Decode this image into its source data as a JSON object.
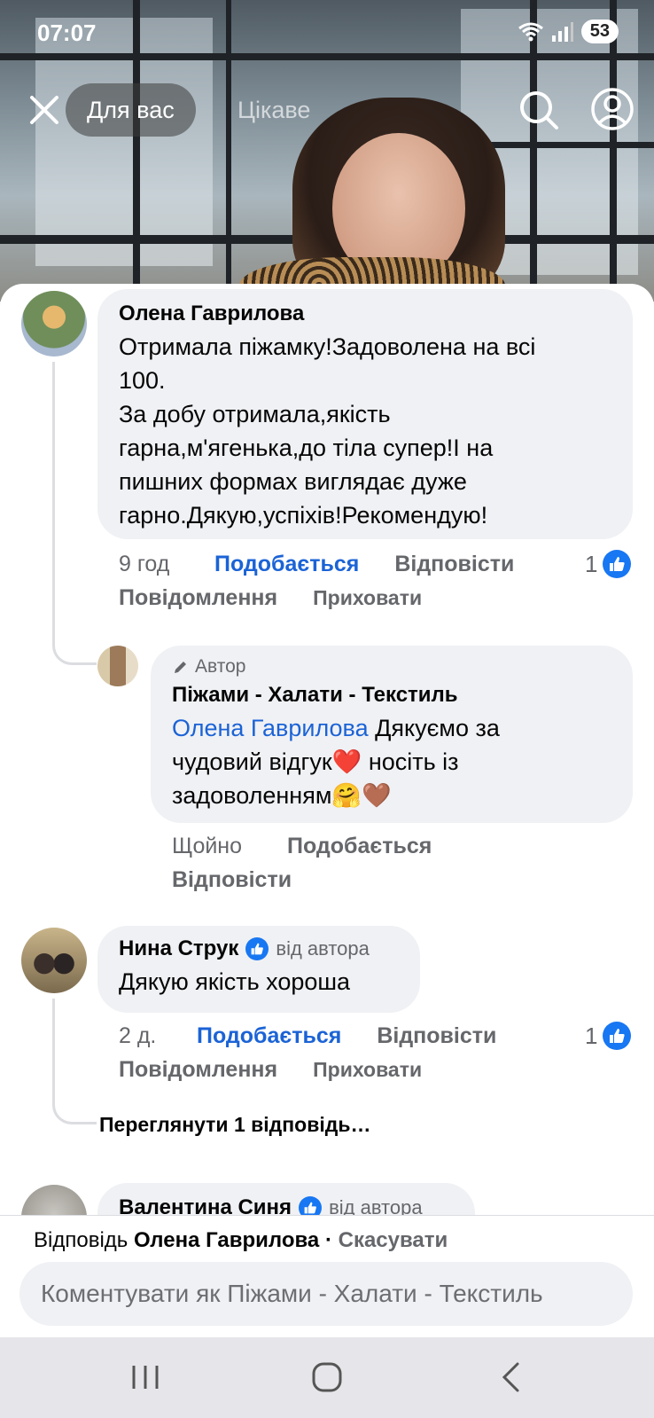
{
  "status_bar": {
    "time": "07:07",
    "battery": "53"
  },
  "top_nav": {
    "tabs": [
      {
        "label": "Для вас"
      },
      {
        "label": "Цікаве"
      }
    ]
  },
  "comments": [
    {
      "author": "Олена Гаврилова",
      "text_lines": [
        "Отримала піжамку!Задоволена на всі",
        "100.",
        "За добу отримала,якість",
        "гарна,м'ягенька,до тіла супер!І на",
        "пишних формах виглядає дуже",
        "гарно.Дякую,успіхів!Рекомендую!"
      ],
      "time": "9 год",
      "like_label": "Подобається",
      "reply_label": "Відповісти",
      "message_label": "Повідомлення",
      "hide_label": "Приховати",
      "like_count": "1",
      "reply": {
        "badge": "Автор",
        "author": "Піжами - Халати - Текстиль",
        "mention": "Олена Гаврилова",
        "text_line1": " Дякуємо за",
        "text_line2": "чудовий відгук❤️ носіть із",
        "text_line3": "задоволенням🤗🤎",
        "time": "Щойно",
        "like_label": "Подобається",
        "reply_label": "Відповісти"
      }
    },
    {
      "author": "Нина Струк",
      "author_badge": "від автора",
      "text": "Дякую якість хороша",
      "time": "2 д.",
      "like_label": "Подобається",
      "reply_label": "Відповісти",
      "message_label": "Повідомлення",
      "hide_label": "Приховати",
      "like_count": "1",
      "view_replies": "Переглянути 1 відповідь…"
    },
    {
      "author": "Валентина Синя",
      "author_badge": "від автора"
    }
  ],
  "reply_bar": {
    "prefix": "Відповідь ",
    "replying_to": "Олена Гаврилова",
    "separator": " · ",
    "cancel": "Скасувати",
    "placeholder": "Коментувати як Піжами - Халати - Текстиль"
  },
  "colors": {
    "accent": "#1b63d6",
    "like_badge": "#1877f2",
    "bubble": "#f0f1f4"
  }
}
